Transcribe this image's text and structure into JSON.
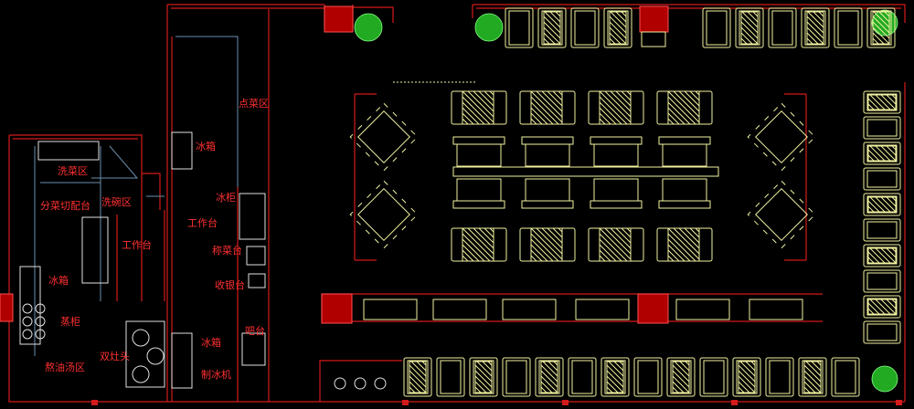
{
  "labels": {
    "dianchaiqu": "点菜区",
    "fridge_top": "冰箱",
    "xicaiqu": "洗菜区",
    "bingui": "冰柜",
    "fencai": "分菜切配台",
    "xiwanqu": "洗碗区",
    "gongzuotai_right": "工作台",
    "gongzuotai_left": "工作台",
    "chengcaitai": "称菜台",
    "shouyintai": "收银台",
    "fridge_left": "冰箱",
    "zhenggui": "蒸柜",
    "bataitai": "吧台",
    "fridge_bottom": "冰箱",
    "shuangzaotou": "双灶头",
    "zhibingji": "制冰机",
    "shuyoutangqu": "熬油汤区"
  },
  "colors": {
    "background": "#000000",
    "wall": "#d41a1a",
    "label": "#ff3030",
    "furniture": "#f2f2a0",
    "equipment": "#e0e0e0",
    "column": "#b00000",
    "plant": "#22aa22",
    "partition": "#6a8fb0"
  }
}
